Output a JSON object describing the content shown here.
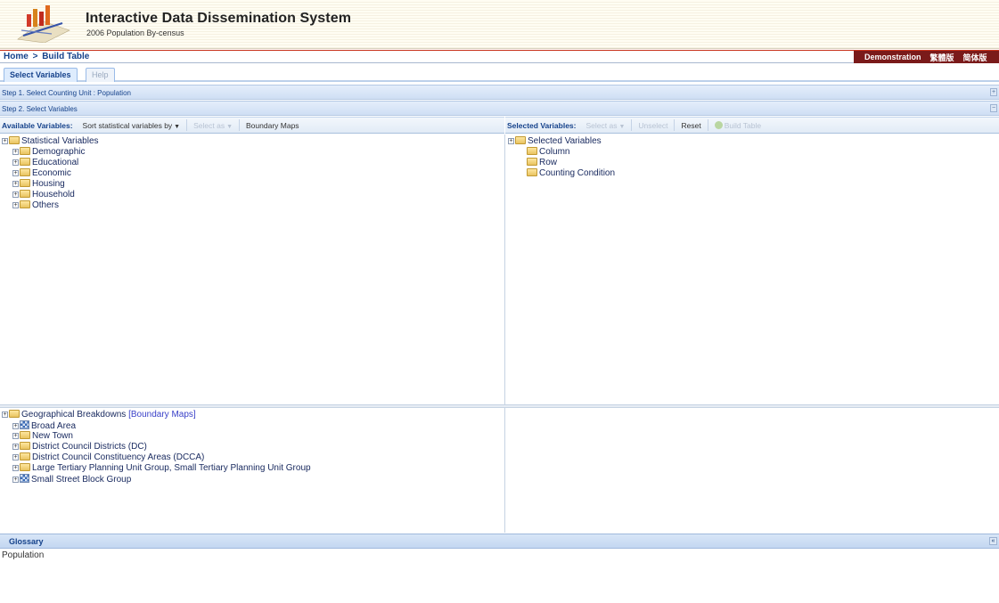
{
  "header": {
    "title": "Interactive Data Dissemination System",
    "subtitle": "2006 Population By-census"
  },
  "breadcrumb": {
    "home": "Home",
    "separator": ">",
    "current": "Build Table"
  },
  "top_right": {
    "demo": "Demonstration",
    "lang_trad": "繁體版",
    "lang_simp": "简体版"
  },
  "tabs": [
    {
      "label": "Select Variables"
    },
    {
      "label": "Help"
    }
  ],
  "steps": {
    "step1": {
      "label": "Step 1. Select Counting Unit : Population",
      "tool": "+"
    },
    "step2": {
      "label": "Step 2. Select Variables",
      "tool": "−"
    }
  },
  "left_toolbar": {
    "title": "Available Variables:",
    "sort": "Sort statistical variables by",
    "select_as": "Select as",
    "boundary": "Boundary Maps"
  },
  "right_toolbar": {
    "title": "Selected Variables:",
    "select_as": "Select as",
    "unselect": "Unselect",
    "reset": "Reset",
    "build": "Build Table"
  },
  "statistical_tree": {
    "root": "Statistical Variables",
    "children": [
      "Demographic",
      "Educational",
      "Economic",
      "Housing",
      "Household",
      "Others"
    ]
  },
  "selected_tree": {
    "root": "Selected Variables",
    "children": [
      "Column",
      "Row",
      "Counting Condition"
    ]
  },
  "geo_tree": {
    "root": "Geographical Breakdowns",
    "root_link": "[Boundary Maps]",
    "children": [
      "Broad Area",
      "New Town",
      "District Council Districts (DC)",
      "District Council Constituency Areas (DCCA)",
      "Large Tertiary Planning Unit Group, Small Tertiary Planning Unit Group",
      "Small Street Block Group"
    ]
  },
  "glossary": {
    "title": "Glossary",
    "text": "Population",
    "tool": "«"
  }
}
